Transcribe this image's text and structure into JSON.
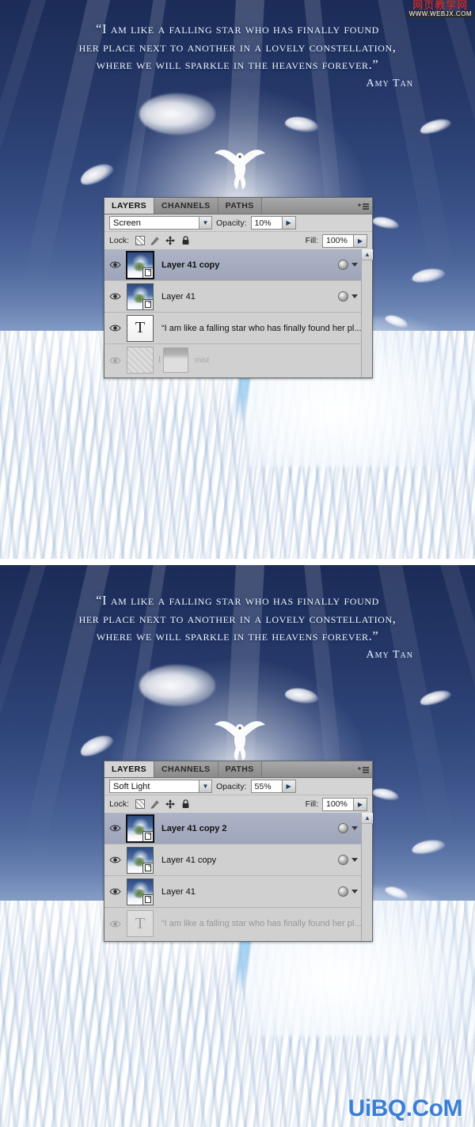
{
  "artwork": {
    "quote_lines": [
      "“I am like a falling star who has finally found",
      "her place next to another in a lovely  constellation,",
      "where we will sparkle in the heavens forever.”"
    ],
    "author": "Amy Tan"
  },
  "watermark": {
    "top_cn": "网页教学网",
    "top_url": "WWW.WEBJX.COM",
    "bottom": "UiBQ.CoM"
  },
  "colors": {
    "sky_top": "#1c2b58",
    "sky_mid": "#4c659a",
    "snow": "#eef4fb",
    "panel_bg": "#d4d4d4",
    "selected_row": "#a6adc0",
    "watermark_bottom": "#3a7fd5",
    "watermark_cn": "#c3312f"
  },
  "panels": [
    {
      "tabs": [
        {
          "label": "LAYERS",
          "active": true
        },
        {
          "label": "CHANNELS",
          "active": false
        },
        {
          "label": "PATHS",
          "active": false
        }
      ],
      "menu_icon": "panel-menu-icon",
      "blend_mode": "Screen",
      "opacity_label": "Opacity:",
      "opacity_value": "10%",
      "lock_label": "Lock:",
      "lock_icons": [
        "lock-transparency-icon",
        "lock-image-icon",
        "lock-position-icon",
        "lock-all-icon"
      ],
      "fill_label": "Fill:",
      "fill_value": "100%",
      "layers": [
        {
          "name": "Layer 41 copy",
          "selected": true,
          "visible": true,
          "thumb": "image",
          "has_fx": true,
          "ghost": false
        },
        {
          "name": "Layer 41",
          "selected": false,
          "visible": true,
          "thumb": "image",
          "has_fx": true,
          "ghost": false
        },
        {
          "name": "“I am like a falling star who has finally found   her pl...",
          "selected": false,
          "visible": true,
          "thumb": "text",
          "has_fx": false,
          "ghost": false
        },
        {
          "name": "mist",
          "selected": false,
          "visible": true,
          "thumb": "checker-mask",
          "has_fx": false,
          "ghost": true
        }
      ]
    },
    {
      "tabs": [
        {
          "label": "LAYERS",
          "active": true
        },
        {
          "label": "CHANNELS",
          "active": false
        },
        {
          "label": "PATHS",
          "active": false
        }
      ],
      "menu_icon": "panel-menu-icon",
      "blend_mode": "Soft Light",
      "opacity_label": "Opacity:",
      "opacity_value": "55%",
      "lock_label": "Lock:",
      "lock_icons": [
        "lock-transparency-icon",
        "lock-image-icon",
        "lock-position-icon",
        "lock-all-icon"
      ],
      "fill_label": "Fill:",
      "fill_value": "100%",
      "layers": [
        {
          "name": "Layer 41 copy 2",
          "selected": true,
          "visible": true,
          "thumb": "image",
          "has_fx": true,
          "ghost": false
        },
        {
          "name": "Layer 41 copy",
          "selected": false,
          "visible": true,
          "thumb": "image",
          "has_fx": true,
          "ghost": false
        },
        {
          "name": "Layer 41",
          "selected": false,
          "visible": true,
          "thumb": "image",
          "has_fx": true,
          "ghost": false
        },
        {
          "name": "“I am like a falling star who has finally found   her pl...",
          "selected": false,
          "visible": true,
          "thumb": "text",
          "has_fx": false,
          "ghost": true
        }
      ]
    }
  ]
}
